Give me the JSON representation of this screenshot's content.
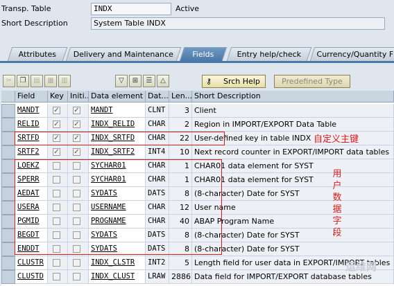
{
  "header": {
    "transp_table_label": "Transp. Table",
    "transp_table_value": "INDX",
    "status": "Active",
    "short_desc_label": "Short Description",
    "short_desc_value": "System Table INDX"
  },
  "tabs": [
    {
      "label": "Attributes",
      "active": false
    },
    {
      "label": "Delivery and Maintenance",
      "active": false
    },
    {
      "label": "Fields",
      "active": true
    },
    {
      "label": "Entry help/check",
      "active": false
    },
    {
      "label": "Currency/Quantity F",
      "active": false
    }
  ],
  "toolbar": {
    "srch_help_label": "Srch Help",
    "predefined_type_label": "Predefined Type"
  },
  "table": {
    "columns": [
      "Field",
      "Key",
      "Initi...",
      "Data element",
      "Dat...",
      "Len...",
      "Short Description"
    ],
    "rows": [
      {
        "field": "MANDT",
        "key": true,
        "init": true,
        "element": "MANDT",
        "type": "CLNT",
        "len": "3",
        "desc": "Client"
      },
      {
        "field": "RELID",
        "key": true,
        "init": true,
        "element": "INDX_RELID",
        "type": "CHAR",
        "len": "2",
        "desc": "Region in IMPORT/EXPORT Data Table"
      },
      {
        "field": "SRTFD",
        "key": true,
        "init": true,
        "element": "INDX_SRTFD",
        "type": "CHAR",
        "len": "22",
        "desc": "User-defined key in table INDX"
      },
      {
        "field": "SRTF2",
        "key": true,
        "init": true,
        "element": "INDX_SRTF2",
        "type": "INT4",
        "len": "10",
        "desc": "Next record counter in EXPORT/IMPORT data tables"
      },
      {
        "field": "LOEKZ",
        "key": false,
        "init": false,
        "element": "SYCHAR01",
        "type": "CHAR",
        "len": "1",
        "desc": "CHAR01  data element for SYST"
      },
      {
        "field": "SPERR",
        "key": false,
        "init": false,
        "element": "SYCHAR01",
        "type": "CHAR",
        "len": "1",
        "desc": "CHAR01  data element for SYST"
      },
      {
        "field": "AEDAT",
        "key": false,
        "init": false,
        "element": "SYDATS",
        "type": "DATS",
        "len": "8",
        "desc": "(8-character) Date for SYST"
      },
      {
        "field": "USERA",
        "key": false,
        "init": false,
        "element": "USERNAME",
        "type": "CHAR",
        "len": "12",
        "desc": "User name"
      },
      {
        "field": "PGMID",
        "key": false,
        "init": false,
        "element": "PROGNAME",
        "type": "CHAR",
        "len": "40",
        "desc": "ABAP Program Name"
      },
      {
        "field": "BEGDT",
        "key": false,
        "init": false,
        "element": "SYDATS",
        "type": "DATS",
        "len": "8",
        "desc": "(8-character) Date for SYST"
      },
      {
        "field": "ENDDT",
        "key": false,
        "init": false,
        "element": "SYDATS",
        "type": "DATS",
        "len": "8",
        "desc": "(8-character) Date for SYST"
      },
      {
        "field": "CLUSTR",
        "key": false,
        "init": false,
        "element": "INDX_CLSTR",
        "type": "INT2",
        "len": "5",
        "desc": "Length field for user data in EXPORT/IMPORT tables"
      },
      {
        "field": "CLUSTD",
        "key": false,
        "init": false,
        "element": "INDX_CLUST",
        "type": "LRAW",
        "len": "2886",
        "desc": "Data field for IMPORT/EXPORT database tables"
      }
    ]
  },
  "annotations": {
    "custom_key_note": "自定义主键",
    "user_data_note": [
      "用",
      "户",
      "数",
      "据",
      "字",
      "段"
    ]
  },
  "watermark": "运维网",
  "colors": {
    "annotation": "#e01818",
    "active_tab": "#4a79a8",
    "header_bg": "#c9d5e1"
  }
}
